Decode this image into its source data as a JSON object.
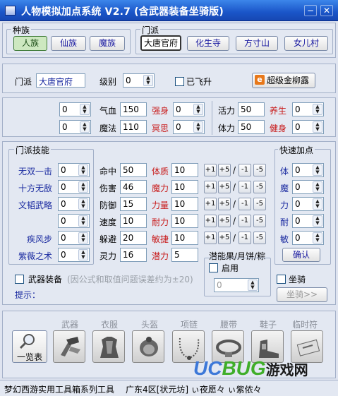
{
  "window": {
    "title": "人物模拟加点系统 V2.7 (含武器装备坐骑版)",
    "minimize": "−",
    "close": "✕"
  },
  "race": {
    "label": "种族",
    "options": [
      "人族",
      "仙族",
      "魔族"
    ],
    "selected": "人族"
  },
  "sect": {
    "label": "门派",
    "options": [
      "大唐官府",
      "化生寺",
      "方寸山",
      "女儿村"
    ],
    "selected": "大唐官府"
  },
  "info": {
    "sect_label": "门派",
    "sect_value": "大唐官府",
    "level_label": "级别",
    "level_value": "0",
    "ascend_label": "已飞升",
    "super_button": "超级金柳露",
    "super_icon": "e"
  },
  "vitals": {
    "left": [
      {
        "spin": "0",
        "label": "气血",
        "value": "150"
      },
      {
        "spin": "0",
        "label": "魔法",
        "value": "110"
      }
    ],
    "mid": [
      {
        "label": "强身",
        "spin": "0"
      },
      {
        "label": "冥思",
        "spin": "0"
      }
    ],
    "right": [
      {
        "label": "活力",
        "value": "50",
        "red_label": "养生",
        "spin": "0"
      },
      {
        "label": "体力",
        "value": "50",
        "red_label": "健身",
        "spin": "0"
      }
    ]
  },
  "skills": {
    "label": "门派技能",
    "items": [
      {
        "name": "无双一击",
        "value": "0"
      },
      {
        "name": "十方无敌",
        "value": "0"
      },
      {
        "name": "文韬武略",
        "value": "0"
      },
      {
        "name": "",
        "value": "0"
      },
      {
        "name": "疾风步",
        "value": "0"
      },
      {
        "name": "紫薇之术",
        "value": "0"
      }
    ]
  },
  "combat": [
    {
      "label": "命中",
      "value": "50",
      "attr": "体质",
      "attr_value": "10"
    },
    {
      "label": "伤害",
      "value": "46",
      "attr": "魔力",
      "attr_value": "10"
    },
    {
      "label": "防御",
      "value": "15",
      "attr": "力量",
      "attr_value": "10"
    },
    {
      "label": "速度",
      "value": "10",
      "attr": "耐力",
      "attr_value": "10"
    },
    {
      "label": "躲避",
      "value": "20",
      "attr": "敏捷",
      "attr_value": "10"
    },
    {
      "label": "灵力",
      "value": "16",
      "attr": "潜力",
      "attr_value": "5"
    }
  ],
  "adjust_buttons": [
    "+1",
    "+5",
    "-1",
    "-5"
  ],
  "adjust_sep": "/",
  "quick": {
    "label": "快速加点",
    "items": [
      {
        "name": "体",
        "value": "0"
      },
      {
        "name": "魔",
        "value": "0"
      },
      {
        "name": "力",
        "value": "0"
      },
      {
        "name": "耐",
        "value": "0"
      },
      {
        "name": "敏",
        "value": "0"
      }
    ],
    "confirm": "确认"
  },
  "potential": {
    "label": "潜能果/月饼/粽",
    "enable": "启用",
    "value": "0"
  },
  "mount": {
    "label": "坐骑",
    "button": "坐骑>>"
  },
  "weapon": {
    "label": "武器装备",
    "note": "(因公式和取值问题误差约为±20)"
  },
  "hint": {
    "label": "提示："
  },
  "equip": {
    "overview": "一览表",
    "slots": [
      "武器",
      "衣服",
      "头盔",
      "项链",
      "腰带",
      "鞋子",
      "临时符"
    ]
  },
  "status": {
    "left": "梦幻西游实用工具箱系列工具",
    "right": "广东4区[状元坊]  ぃ夜愿々  ぃ紫侬々"
  },
  "watermark": {
    "ucb": "UC",
    "bug": "BUG",
    "cn": "游戏网",
    "com": ".com"
  },
  "colors": {
    "title_bar": "#1a55c8",
    "label_blue": "#1a2aa0",
    "label_red": "#c81a1a"
  }
}
